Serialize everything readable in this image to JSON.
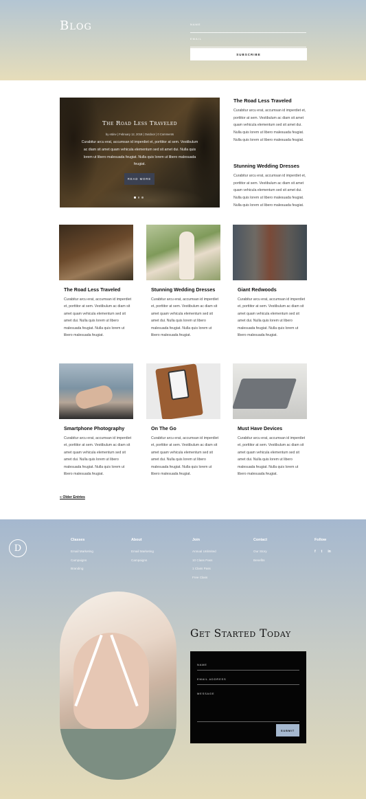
{
  "header": {
    "title": "Blog",
    "name_label": "NAME",
    "email_label": "EMAIL",
    "subscribe_label": "SUBSCRIBE"
  },
  "featured": {
    "title": "The Road Less Traveled",
    "meta": "by etdev | February 12, 2018 | Outdoor | 0 Comments",
    "excerpt": "Curabitur arcu erat, accumsan id imperdiet et, porttitor at sem. Vestibulum ac diam sit amet quam vehicula elementum sed sit amet dui. Nulla quis lorem ut libero malesuada feugiat. Nulla quis lorem ut libero malesuada feugiat.",
    "button": "READ MORE"
  },
  "side_posts": [
    {
      "title": "The Road Less Traveled",
      "excerpt": "Curabitur arcu erat, accumsan id imperdiet et, porttitor at sem. Vestibulum ac diam sit amet quam vehicula elementum sed sit amet dui. Nulla quis lorem ut libero malesuada feugiat. Nulla quis lorem ut libero malesuada feugiat."
    },
    {
      "title": "Stunning Wedding Dresses",
      "excerpt": "Curabitur arcu erat, accumsan id imperdiet et, porttitor at sem. Vestibulum ac diam sit amet quam vehicula elementum sed sit amet dui. Nulla quis lorem ut libero malesuada feugiat. Nulla quis lorem ut libero malesuada feugiat."
    }
  ],
  "posts": [
    {
      "title": "The Road Less Traveled",
      "excerpt": "Curabitur arcu erat, accumsan id imperdiet et, porttitor at sem. Vestibulum ac diam sit amet quam vehicula elementum sed sit amet dui. Nulla quis lorem ut libero malesuada feugiat. Nulla quis lorem ut libero malesuada feugiat."
    },
    {
      "title": "Stunning Wedding Dresses",
      "excerpt": "Curabitur arcu erat, accumsan id imperdiet et, porttitor at sem. Vestibulum ac diam sit amet quam vehicula elementum sed sit amet dui. Nulla quis lorem ut libero malesuada feugiat. Nulla quis lorem ut libero malesuada feugiat."
    },
    {
      "title": "Giant Redwoods",
      "excerpt": "Curabitur arcu erat, accumsan id imperdiet et, porttitor at sem. Vestibulum ac diam sit amet quam vehicula elementum sed sit amet dui. Nulla quis lorem ut libero malesuada feugiat. Nulla quis lorem ut libero malesuada feugiat."
    },
    {
      "title": "Smartphone Photography",
      "excerpt": "Curabitur arcu erat, accumsan id imperdiet et, porttitor at sem. Vestibulum ac diam sit amet quam vehicula elementum sed sit amet dui. Nulla quis lorem ut libero malesuada feugiat. Nulla quis lorem ut libero malesuada feugiat."
    },
    {
      "title": "On The Go",
      "excerpt": "Curabitur arcu erat, accumsan id imperdiet et, porttitor at sem. Vestibulum ac diam sit amet quam vehicula elementum sed sit amet dui. Nulla quis lorem ut libero malesuada feugiat. Nulla quis lorem ut libero malesuada feugiat."
    },
    {
      "title": "Must Have Devices",
      "excerpt": "Curabitur arcu erat, accumsan id imperdiet et, porttitor at sem. Vestibulum ac diam sit amet quam vehicula elementum sed sit amet dui. Nulla quis lorem ut libero malesuada feugiat. Nulla quis lorem ut libero malesuada feugiat."
    }
  ],
  "older_entries": "« Older Entries",
  "footer": {
    "logo": "D",
    "columns": [
      {
        "heading": "Classes",
        "links": [
          "Email Marketing",
          "Campaigns",
          "Branding"
        ]
      },
      {
        "heading": "About",
        "links": [
          "Email Marketing",
          "Campaigns"
        ]
      },
      {
        "heading": "Join",
        "links": [
          "Annual Unlimited",
          "10 Class Pass",
          "1 Class Pass",
          "Free Class"
        ]
      },
      {
        "heading": "Contact",
        "links": [
          "Our Story",
          "Benefits"
        ]
      },
      {
        "heading": "Follow",
        "links": []
      }
    ],
    "social": [
      "f",
      "t",
      "in"
    ],
    "cta_title": "Get Started Today",
    "form": {
      "name_label": "NAME",
      "email_label": "EMAIL ADDRESS",
      "message_label": "MESSAGE",
      "submit_label": "SUBMIT"
    }
  },
  "colors": {
    "accent": "#a5b8cf",
    "dark": "#050505",
    "button_dark": "#3b4152"
  }
}
